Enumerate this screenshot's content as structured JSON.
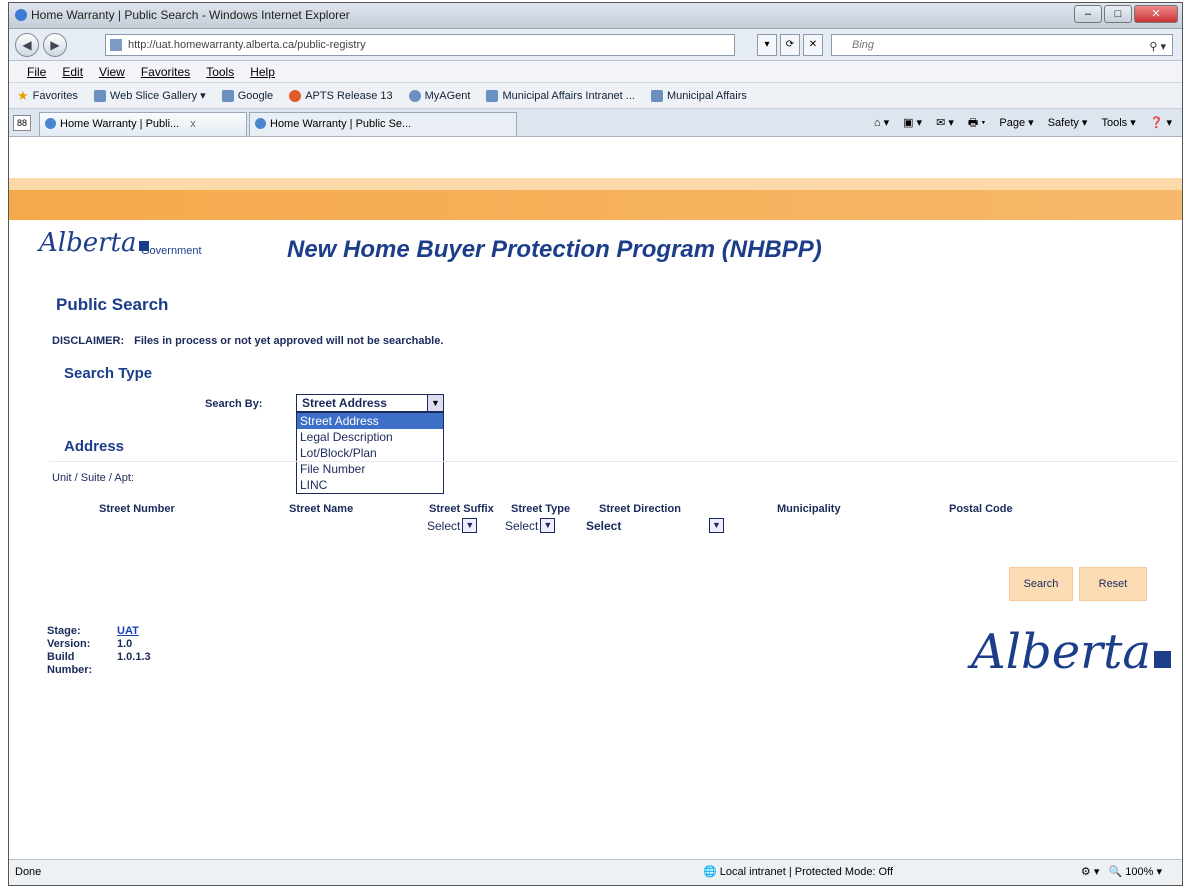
{
  "window": {
    "title": "Home Warranty | Public Search - Windows Internet Explorer",
    "controls": [
      "–",
      "□",
      "✕"
    ]
  },
  "addressbar": {
    "url": "http://uat.homewarranty.alberta.ca/public-registry",
    "search_placeholder": "Bing",
    "search_icon": "magnifier-icon",
    "go_glyphs": [
      "▾",
      "⟳",
      "✕"
    ]
  },
  "menu": [
    "File",
    "Edit",
    "View",
    "Favorites",
    "Tools",
    "Help"
  ],
  "favorites": {
    "label": "Favorites",
    "items": [
      "Web Slice Gallery ▾",
      "Google",
      "APTS Release 13",
      "MyAGent",
      "Municipal Affairs Intranet ...",
      "Municipal Affairs"
    ]
  },
  "tabs": [
    {
      "label": "Home Warranty | Publi...",
      "close": "x"
    },
    {
      "label": "Home Warranty | Public Se..."
    }
  ],
  "command_bar": [
    "⌂ ▾",
    "▣ ▾",
    "✉ ▾",
    "🖶 ▾",
    "Page ▾",
    "Safety ▾",
    "Tools ▾",
    "❓ ▾"
  ],
  "quicktabs_glyph": "88",
  "brand": {
    "logo_text": "Alberta",
    "gov_text": "Government",
    "app_title": "New Home Buyer Protection Program (NHBPP)",
    "accent": "#1c3e8a",
    "orange": "#f6a94a"
  },
  "search": {
    "heading": "Public Search",
    "disclaimer_label": "DISCLAIMER:",
    "disclaimer_text": "Files in process or not yet approved will not be searchable.",
    "type_heading": "Search Type",
    "search_by_label": "Search By:",
    "search_by_value": "Street Address",
    "search_by_options": [
      "Street Address",
      "Legal Description",
      "Lot/Block/Plan",
      "File Number",
      "LINC"
    ],
    "selected_index": 0
  },
  "address": {
    "heading": "Address",
    "unit_label": "Unit / Suite / Apt:",
    "columns": [
      "Street Number",
      "Street Name",
      "Street Suffix",
      "Street Type",
      "Street Direction",
      "Municipality",
      "Postal Code"
    ],
    "suffix_value": "Select",
    "type_value": "Select",
    "direction_value": "Select"
  },
  "buttons": {
    "search": "Search",
    "reset": "Reset"
  },
  "meta": [
    {
      "label": "Stage:",
      "value": "UAT"
    },
    {
      "label": "Version:",
      "value": "1.0"
    },
    {
      "label": "Build Number:",
      "value": "1.0.1.3"
    }
  ],
  "status": {
    "left": "Done",
    "zone": "Local intranet | Protected Mode: Off",
    "zoom": "100%"
  }
}
